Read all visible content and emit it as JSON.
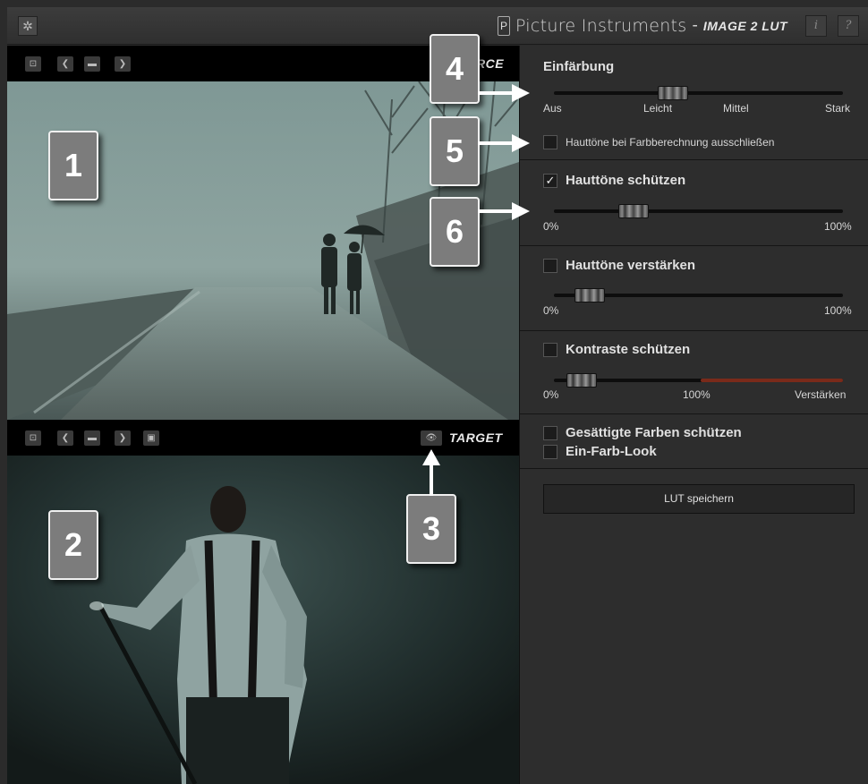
{
  "titlebar": {
    "logo_glyph": "P",
    "brand_name": "Picture Instruments",
    "separator": "-",
    "product": "IMAGE 2 LUT",
    "info_label": "i",
    "help_label": "?"
  },
  "source": {
    "label": "RCE"
  },
  "target": {
    "label": "TARGET"
  },
  "callouts": [
    "1",
    "2",
    "3",
    "4",
    "5",
    "6"
  ],
  "einfaerbung": {
    "title": "Einfärbung",
    "value_fraction": 0.4,
    "scale": [
      "Aus",
      "Leicht",
      "Mittel",
      "Stark"
    ]
  },
  "exclude_skin": {
    "label": "Hauttöne bei Farbberechnung ausschließen",
    "checked": false
  },
  "protect_skin": {
    "label": "Hauttöne schützen",
    "checked": true,
    "checkmark": "✓",
    "value_percent": 25,
    "min_label": "0%",
    "max_label": "100%"
  },
  "enhance_skin": {
    "label": "Hauttöne verstärken",
    "checked": false,
    "value_percent": 8,
    "min_label": "0%",
    "max_label": "100%"
  },
  "protect_contrast": {
    "label": "Kontraste schützen",
    "checked": false,
    "value_percent": 5,
    "min_label": "0%",
    "mid_label": "100%",
    "max_label": "Verstärken"
  },
  "saturated": {
    "label": "Gesättigte Farben schützen",
    "checked": false
  },
  "single_color": {
    "label": "Ein-Farb-Look",
    "checked": false
  },
  "lut_button": {
    "label": "LUT speichern"
  },
  "colors": {
    "accent_red": "#7a2a1a",
    "panel_bg": "#2d2d2d"
  }
}
